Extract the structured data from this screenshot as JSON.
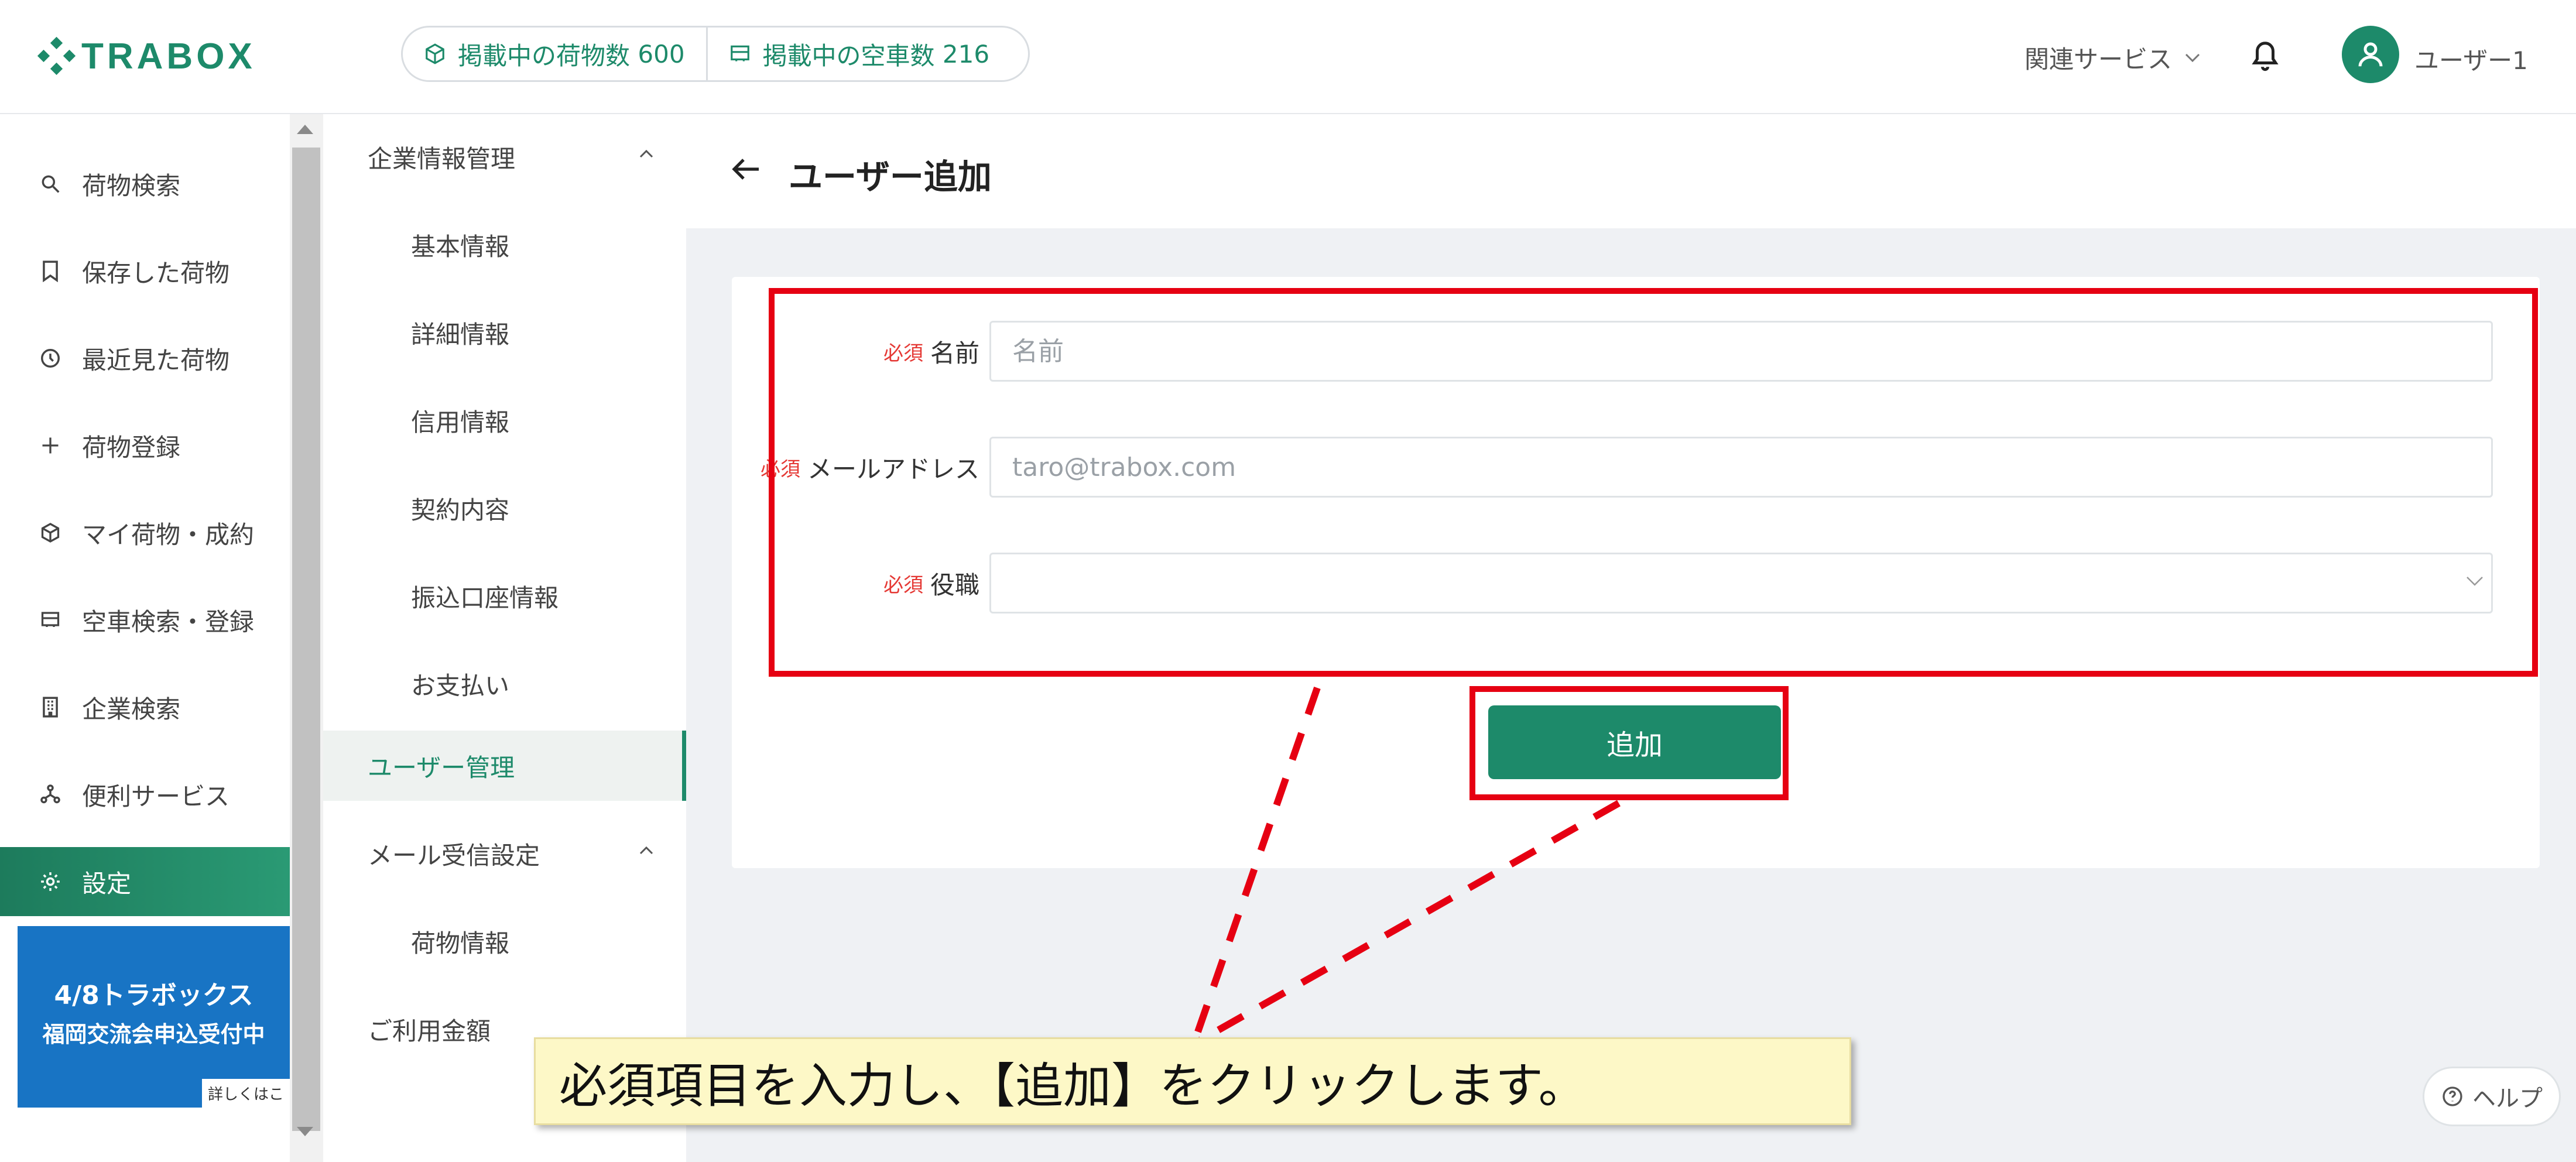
{
  "header": {
    "logo": "TRABOX",
    "stats": [
      {
        "label": "掲載中の荷物数",
        "count": "600",
        "icon": "package-icon"
      },
      {
        "label": "掲載中の空車数",
        "count": "216",
        "icon": "truck-icon"
      }
    ],
    "related_services": "関連サービス",
    "user_name": "ユーザー1"
  },
  "leftnav": {
    "items": [
      {
        "label": "荷物検索",
        "icon": "search-icon"
      },
      {
        "label": "保存した荷物",
        "icon": "bookmark-icon"
      },
      {
        "label": "最近見た荷物",
        "icon": "history-icon"
      },
      {
        "label": "荷物登録",
        "icon": "plus-icon"
      },
      {
        "label": "マイ荷物・成約",
        "icon": "package-icon"
      },
      {
        "label": "空車検索・登録",
        "icon": "truck-icon"
      },
      {
        "label": "企業検索",
        "icon": "building-icon"
      },
      {
        "label": "便利サービス",
        "icon": "network-icon"
      },
      {
        "label": "設定",
        "icon": "gear-icon"
      }
    ],
    "banner": {
      "line1": "4/8トラボックス",
      "line2": "福岡交流会申込受付中",
      "button": "詳しくはこ"
    }
  },
  "subnav": {
    "items": [
      {
        "label": "企業情報管理",
        "type": "group"
      },
      {
        "label": "基本情報",
        "type": "child"
      },
      {
        "label": "詳細情報",
        "type": "child"
      },
      {
        "label": "信用情報",
        "type": "child"
      },
      {
        "label": "契約内容",
        "type": "child"
      },
      {
        "label": "振込口座情報",
        "type": "child"
      },
      {
        "label": "お支払い",
        "type": "child"
      },
      {
        "label": "ユーザー管理",
        "type": "group"
      },
      {
        "label": "メール受信設定",
        "type": "group"
      },
      {
        "label": "荷物情報",
        "type": "child"
      },
      {
        "label": "ご利用金額",
        "type": "group"
      }
    ]
  },
  "main": {
    "title": "ユーザー追加",
    "form": {
      "required": "必須",
      "fields": [
        {
          "label": "名前",
          "placeholder": "名前",
          "value": ""
        },
        {
          "label": "メールアドレス",
          "placeholder": "taro@trabox.com",
          "value": ""
        },
        {
          "label": "役職",
          "value": ""
        }
      ],
      "submit": "追加"
    }
  },
  "annotation": {
    "callout": "必須項目を入力し、【追加】をクリックします。"
  },
  "help": "ヘルプ",
  "colors": {
    "brand": "#1d8a6a",
    "annotation_red": "#e60012",
    "required_red": "#e53935",
    "banner_blue": "#1874c4",
    "callout_bg": "#fdf8c7"
  }
}
